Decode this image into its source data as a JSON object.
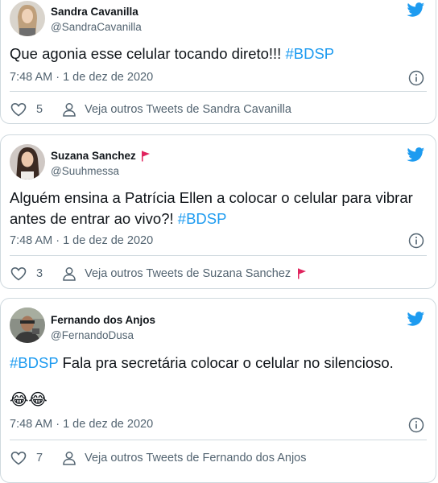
{
  "tweets": [
    {
      "name": "Sandra Cavanilla",
      "handle": "@SandraCavanilla",
      "text": "Que agonia esse celular tocando direto!!!",
      "hashtag": "#BDSP",
      "timestamp": "7:48 AM · 1 de dez de 2020",
      "likes": "5",
      "more_tweets": "Veja outros Tweets de Sandra Cavanilla"
    },
    {
      "name": "Suzana Sanchez",
      "handle": "@Suuhmessa",
      "text": "Alguém ensina a Patrícia Ellen a colocar o celular para vibrar antes de entrar ao vivo?!",
      "hashtag": "#BDSP",
      "timestamp": "7:48 AM · 1 de dez de 2020",
      "likes": "3",
      "more_tweets": "Veja outros Tweets de Suzana Sanchez"
    },
    {
      "name": "Fernando dos Anjos",
      "handle": "@FernandoDusa",
      "hashtag": "#BDSP",
      "text": "Fala pra secretária colocar o celular no silencioso.",
      "emoji": "😂😂",
      "timestamp": "7:48 AM · 1 de dez de 2020",
      "likes": "7",
      "more_tweets": "Veja outros Tweets de Fernando dos Anjos"
    }
  ],
  "colors": {
    "twitter_blue": "#1d9bf0",
    "text": "#0f1419",
    "muted": "#536471",
    "border": "#cfd9de",
    "flag_red": "#e0245e"
  },
  "icons": [
    "twitter-bird-icon",
    "info-icon",
    "heart-icon",
    "person-icon",
    "red-flag-icon"
  ]
}
